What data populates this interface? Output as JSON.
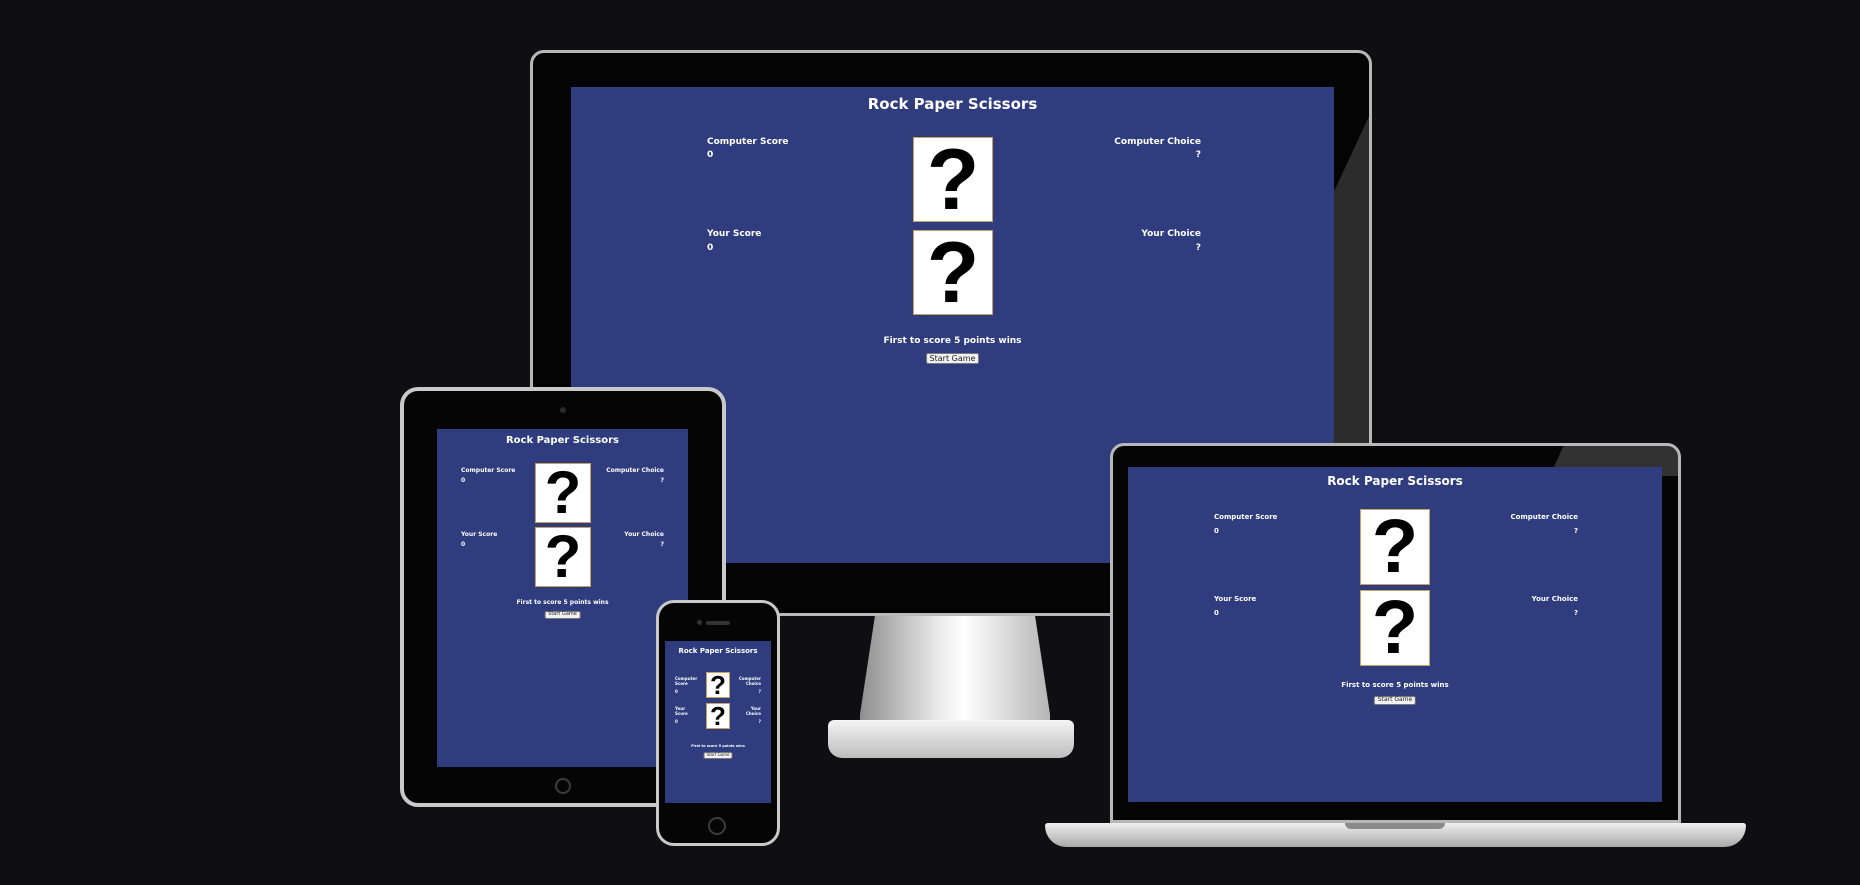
{
  "app": {
    "title": "Rock Paper Scissors",
    "computer_score_label": "Computer Score",
    "computer_score_value": "0",
    "computer_choice_label": "Computer Choice",
    "computer_choice_value": "?",
    "your_score_label": "Your Score",
    "your_score_value": "0",
    "your_choice_label": "Your Choice",
    "your_choice_value": "?",
    "question_mark": "?",
    "rule_text": "First to score 5 points wins",
    "start_button_label": "Start Game"
  },
  "phone": {
    "computer_score_lines": [
      "Computer",
      "Score"
    ],
    "computer_choice_lines": [
      "Computer",
      "Choice"
    ],
    "your_score_lines": [
      "Your",
      "Score"
    ],
    "your_choice_lines": [
      "Your",
      "Choice"
    ]
  },
  "colors": {
    "background": "#0f0e10",
    "screen": "#2f3c7e",
    "text": "#ffffff",
    "image_box_border": "#c9a15c"
  }
}
